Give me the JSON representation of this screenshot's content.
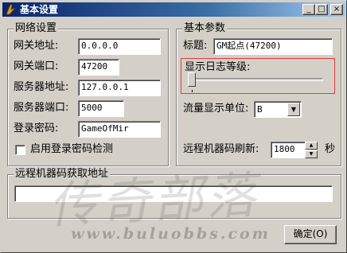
{
  "window": {
    "title": "基本设置",
    "buttons": {
      "minimize": "_",
      "maximize": "□",
      "close": "×"
    }
  },
  "network": {
    "title": "网络设置",
    "gateway_address_label": "网关地址:",
    "gateway_address": "0.0.0.0",
    "gateway_port_label": "网关端口:",
    "gateway_port": "47200",
    "server_address_label": "服务器地址:",
    "server_address": "127.0.0.1",
    "server_port_label": "服务器端口:",
    "server_port": "5000",
    "password_label": "登录密码:",
    "password": "GameOfMir",
    "check_label": "启用登录密码检测",
    "check_checked": false
  },
  "basic": {
    "title": "基本参数",
    "caption_label": "标题:",
    "caption_value": "GM起点(47200)",
    "log_level_label": "显示日志等级:",
    "log_level": 0,
    "unit_label": "流量显示单位:",
    "unit_value": "B",
    "refresh_label": "远程机器码刷新:",
    "refresh_value": "1800",
    "refresh_unit": "秒"
  },
  "remote": {
    "title": "远程机器码获取地址",
    "url": ""
  },
  "ok_button": "确定(O)",
  "watermark": {
    "big": "传奇部落",
    "url": "www.buluobbs.com"
  }
}
